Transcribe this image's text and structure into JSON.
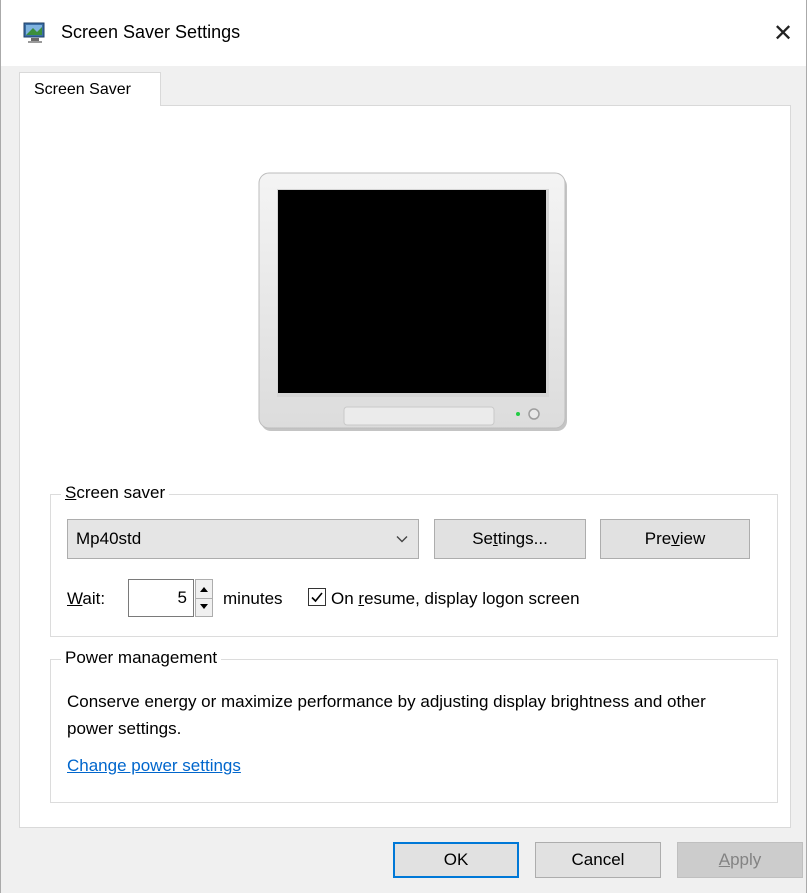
{
  "window": {
    "title": "Screen Saver Settings",
    "close_glyph": "✕"
  },
  "tabs": [
    {
      "label": "Screen Saver"
    }
  ],
  "screen_saver_group": {
    "title_pre": "",
    "title_ul": "S",
    "title_post": "creen saver",
    "selected": "Mp40std",
    "settings_pre": "Se",
    "settings_ul": "t",
    "settings_post": "tings...",
    "preview_pre": "Pre",
    "preview_ul": "v",
    "preview_post": "iew",
    "wait_pre": "",
    "wait_ul": "W",
    "wait_post": "ait:",
    "wait_value": "5",
    "minutes_label": "minutes",
    "resume_checked": true,
    "resume_pre": "On ",
    "resume_ul": "r",
    "resume_post": "esume, display logon screen"
  },
  "power_group": {
    "title": "Power management",
    "description": "Conserve energy or maximize performance by adjusting display brightness and other power settings.",
    "link": "Change power settings"
  },
  "footer": {
    "ok": "OK",
    "cancel": "Cancel",
    "apply_pre": "",
    "apply_ul": "A",
    "apply_post": "pply"
  },
  "colors": {
    "accent": "#0078d7",
    "link": "#0066cc"
  },
  "icons": {
    "app": "monitor-screensaver-icon",
    "combo": "chevron-down-icon",
    "spin_up": "triangle-up-icon",
    "spin_down": "triangle-down-icon",
    "check": "checkmark-icon"
  }
}
